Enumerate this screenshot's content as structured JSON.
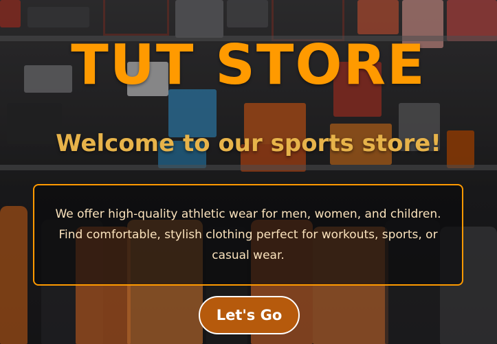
{
  "hero": {
    "title": "TUT STORE",
    "subtitle": "Welcome to our sports store!",
    "description": "We offer high-quality athletic wear for men, women, and children. Find comfortable, stylish clothing perfect for workouts, sports, or casual wear.",
    "cta_label": "Let's Go"
  },
  "colors": {
    "title": "#ff9a00",
    "subtitle": "#e7b34a",
    "box_border": "#ff9a00",
    "button_bg": "#b65a0c",
    "button_border": "#ffffff"
  }
}
